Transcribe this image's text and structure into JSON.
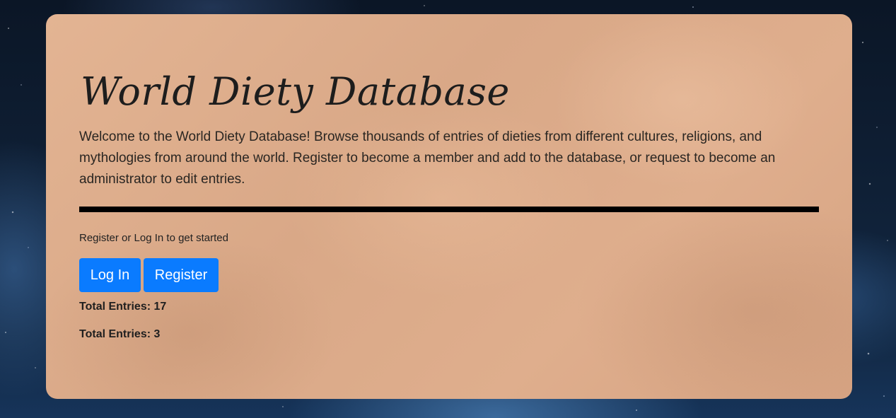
{
  "header": {
    "title": "World Diety Database"
  },
  "intro": {
    "text": "Welcome to the World Diety Database! Browse thousands of entries of dieties from different cultures, religions, and mythologies from around the world. Register to become a member and add to the database, or request to become an administrator to edit entries."
  },
  "auth": {
    "prompt": "Register or Log In to get started",
    "login_label": "Log In",
    "register_label": "Register"
  },
  "stats": [
    {
      "label": "Total Entries: 17"
    },
    {
      "label": "Total Entries: 3"
    }
  ],
  "colors": {
    "button_bg": "#0a7bff",
    "card_bg": "#dfae8d",
    "divider": "#000000"
  }
}
